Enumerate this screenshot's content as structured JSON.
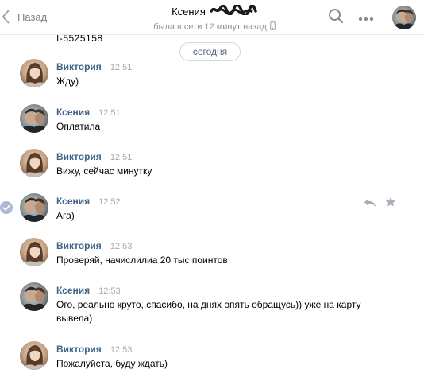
{
  "header": {
    "back_label": "Назад",
    "peer_name": "Ксения",
    "peer_status": "была в сети 12 минут назад"
  },
  "history": {
    "cut_off_text": "I-5525158",
    "date_divider": "сегодня"
  },
  "messages": [
    {
      "author": "Виктория",
      "time": "12:51",
      "text": "Жду)"
    },
    {
      "author": "Ксения",
      "time": "12:51",
      "text": "Оплатила"
    },
    {
      "author": "Виктория",
      "time": "12:51",
      "text": "Вижу, сейчас минутку"
    },
    {
      "author": "Ксения",
      "time": "12:52",
      "text": "Ага)",
      "selected": true
    },
    {
      "author": "Виктория",
      "time": "12:53",
      "text": "Проверяй, начислилиа 20 тыс поинтов"
    },
    {
      "author": "Ксения",
      "time": "12:53",
      "text": "Ого, реально круто, спасибо, на днях опять обращусь)) уже на карту вывела)"
    },
    {
      "author": "Виктория",
      "time": "12:53",
      "text": "Пожалуйста, буду ждать)"
    }
  ],
  "icons": {
    "back": "chevron-left-icon",
    "search": "search-icon",
    "more": "more-dots-icon",
    "mobile": "phone-icon",
    "check": "checkmark-circle-icon",
    "reply": "reply-icon",
    "star": "star-icon"
  },
  "colors": {
    "author_link": "#42648b",
    "timestamp": "#a8acb2",
    "selected_check": "#5181b8",
    "secondary_text": "#939393"
  }
}
